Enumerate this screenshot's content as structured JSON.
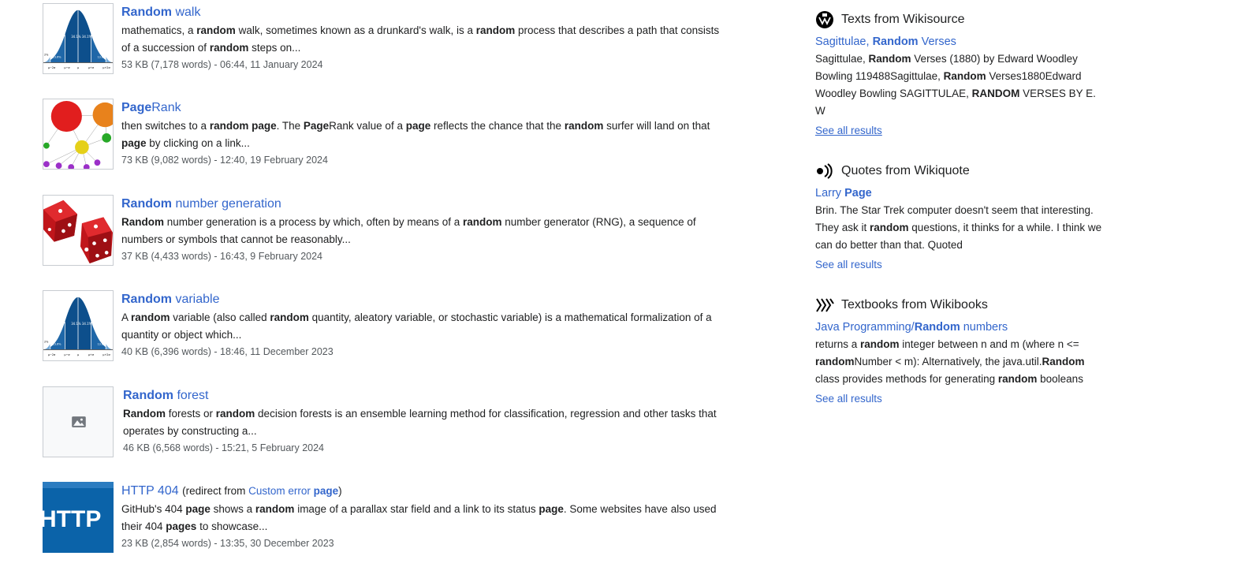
{
  "results": [
    {
      "title_bold": "Random",
      "title_rest": " walk",
      "thumb_icon": "normal-distribution-image",
      "snippet": [
        {
          "t": "mathematics, a ",
          "b": false
        },
        {
          "t": "random",
          "b": true
        },
        {
          "t": " walk, sometimes known as a drunkard's walk, is a ",
          "b": false
        },
        {
          "t": "random",
          "b": true
        },
        {
          "t": " process that describes a path that consists of a succession of ",
          "b": false
        },
        {
          "t": "random",
          "b": true
        },
        {
          "t": " steps on...",
          "b": false
        }
      ],
      "meta": "53 KB (7,178 words) - 06:44, 11 January 2024"
    },
    {
      "title_bold": "Page",
      "title_rest": "Rank",
      "thumb_icon": "pagerank-graph-image",
      "snippet": [
        {
          "t": "then switches to a ",
          "b": false
        },
        {
          "t": "random page",
          "b": true
        },
        {
          "t": ". The ",
          "b": false
        },
        {
          "t": "Page",
          "b": true
        },
        {
          "t": "Rank value of a ",
          "b": false
        },
        {
          "t": "page",
          "b": true
        },
        {
          "t": " reflects the chance that the ",
          "b": false
        },
        {
          "t": "random",
          "b": true
        },
        {
          "t": " surfer will land on that ",
          "b": false
        },
        {
          "t": "page",
          "b": true
        },
        {
          "t": " by clicking on a link...",
          "b": false
        }
      ],
      "meta": "73 KB (9,082 words) - 12:40, 19 February 2024"
    },
    {
      "title_bold": "Random",
      "title_rest": " number generation",
      "thumb_icon": "dice-image",
      "snippet": [
        {
          "t": "Random",
          "b": true
        },
        {
          "t": " number generation is a process by which, often by means of a ",
          "b": false
        },
        {
          "t": "random",
          "b": true
        },
        {
          "t": " number generator (RNG), a sequence of numbers or symbols that cannot be reasonably...",
          "b": false
        }
      ],
      "meta": "37 KB (4,433 words) - 16:43, 9 February 2024"
    },
    {
      "title_bold": "Random",
      "title_rest": " variable",
      "thumb_icon": "normal-distribution-image",
      "snippet": [
        {
          "t": "A ",
          "b": false
        },
        {
          "t": "random",
          "b": true
        },
        {
          "t": " variable (also called ",
          "b": false
        },
        {
          "t": "random",
          "b": true
        },
        {
          "t": " quantity, aleatory variable, or stochastic variable) is a mathematical formalization of a quantity or object which...",
          "b": false
        }
      ],
      "meta": "40 KB (6,396 words) - 18:46, 11 December 2023"
    },
    {
      "title_bold": "Random",
      "title_rest": " forest",
      "thumb_icon": "image-placeholder-icon",
      "snippet": [
        {
          "t": "Random",
          "b": true
        },
        {
          "t": " forests or ",
          "b": false
        },
        {
          "t": "random",
          "b": true
        },
        {
          "t": " decision forests is an ensemble learning method for classification, regression and other tasks that operates by constructing a...",
          "b": false
        }
      ],
      "meta": "46 KB (6,568 words) - 15:21, 5 February 2024"
    },
    {
      "title_bold": "",
      "title_rest": "HTTP 404",
      "thumb_icon": "http-logo-image",
      "redirect_prefix": "(redirect from ",
      "redirect_link_plain": "Custom error ",
      "redirect_link_bold": "page",
      "redirect_suffix": ")",
      "snippet": [
        {
          "t": "GitHub's 404 ",
          "b": false
        },
        {
          "t": "page",
          "b": true
        },
        {
          "t": " shows a ",
          "b": false
        },
        {
          "t": "random",
          "b": true
        },
        {
          "t": " image of a parallax star field and a link to its status ",
          "b": false
        },
        {
          "t": "page",
          "b": true
        },
        {
          "t": ". Some websites have also used their 404 ",
          "b": false
        },
        {
          "t": "pages",
          "b": true
        },
        {
          "t": " to showcase...",
          "b": false
        }
      ],
      "meta": "23 KB (2,854 words) - 13:35, 30 December 2023"
    }
  ],
  "sidebar": [
    {
      "heading": "Texts from Wikisource",
      "icon": "wikisource-icon",
      "title": [
        {
          "t": "Sagittulae, ",
          "b": false
        },
        {
          "t": "Random",
          "b": true
        },
        {
          "t": " Verses",
          "b": false
        }
      ],
      "snippet": [
        {
          "t": "Sagittulae, ",
          "b": false
        },
        {
          "t": "Random",
          "b": true
        },
        {
          "t": " Verses (1880) by Edward Woodley Bowling 119488Sagittulae, ",
          "b": false
        },
        {
          "t": "Random",
          "b": true
        },
        {
          "t": " Verses1880Edward Woodley Bowling SAGITTULAE, ",
          "b": false
        },
        {
          "t": "RANDOM",
          "b": true
        },
        {
          "t": " VERSES BY E. W",
          "b": false
        }
      ],
      "see_all": "See all results"
    },
    {
      "heading": "Quotes from Wikiquote",
      "icon": "wikiquote-icon",
      "title": [
        {
          "t": "Larry ",
          "b": false
        },
        {
          "t": "Page",
          "b": true
        }
      ],
      "snippet": [
        {
          "t": "Brin. The Star Trek computer doesn't seem that interesting. They ask it ",
          "b": false
        },
        {
          "t": "random",
          "b": true
        },
        {
          "t": " questions, it thinks for a while. I think we can do better than that. Quoted",
          "b": false
        }
      ],
      "see_all": "See all results"
    },
    {
      "heading": "Textbooks from Wikibooks",
      "icon": "wikibooks-icon",
      "title": [
        {
          "t": "Java Programming/",
          "b": false
        },
        {
          "t": "Random",
          "b": true
        },
        {
          "t": " numbers",
          "b": false
        }
      ],
      "snippet": [
        {
          "t": "returns a ",
          "b": false
        },
        {
          "t": "random",
          "b": true
        },
        {
          "t": " integer between n and m (where n <= ",
          "b": false
        },
        {
          "t": "random",
          "b": true
        },
        {
          "t": "Number < m): Alternatively, the java.util.",
          "b": false
        },
        {
          "t": "Random",
          "b": true
        },
        {
          "t": " class provides methods for generating ",
          "b": false
        },
        {
          "t": "random",
          "b": true
        },
        {
          "t": " booleans",
          "b": false
        }
      ],
      "see_all": "See all results"
    }
  ],
  "colors": {
    "link": "#3366cc",
    "text": "#202122",
    "meta": "#54595d",
    "border": "#c8ccd1"
  }
}
